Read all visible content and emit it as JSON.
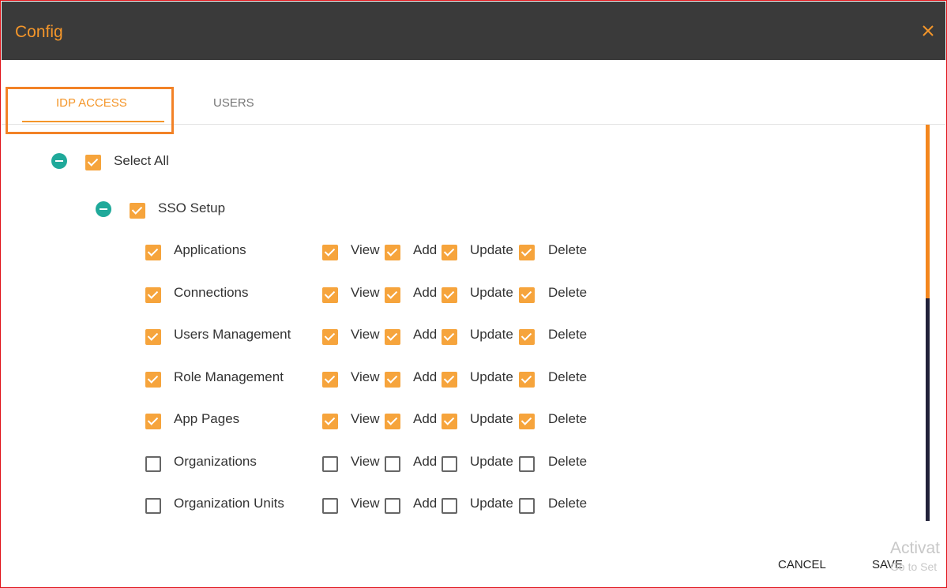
{
  "dialog": {
    "title": "Config"
  },
  "tabs": [
    {
      "label": "IDP ACCESS"
    },
    {
      "label": "USERS"
    }
  ],
  "tree": {
    "select_all": {
      "label": "Select All",
      "checked": true
    },
    "group": {
      "label": "SSO Setup",
      "checked": true
    },
    "permission_labels": [
      "View",
      "Add",
      "Update",
      "Delete"
    ],
    "rows": [
      {
        "label": "Applications",
        "checked": true,
        "perms": [
          true,
          true,
          true,
          true
        ]
      },
      {
        "label": "Connections",
        "checked": true,
        "perms": [
          true,
          true,
          true,
          true
        ]
      },
      {
        "label": "Users Management",
        "checked": true,
        "perms": [
          true,
          true,
          true,
          true
        ]
      },
      {
        "label": "Role Management",
        "checked": true,
        "perms": [
          true,
          true,
          true,
          true
        ]
      },
      {
        "label": "App Pages",
        "checked": true,
        "perms": [
          true,
          true,
          true,
          true
        ]
      },
      {
        "label": "Organizations",
        "checked": false,
        "perms": [
          false,
          false,
          false,
          false
        ]
      },
      {
        "label": "Organization Units",
        "checked": false,
        "perms": [
          false,
          false,
          false,
          false
        ]
      }
    ]
  },
  "footer": {
    "cancel_label": "CANCEL",
    "save_label": "SAVE"
  },
  "watermark": {
    "line1": "Activat",
    "line2": "Go to Set"
  },
  "colors": {
    "accent": "#f4962a",
    "header_bg": "#3a3a3a",
    "tree_toggle": "#1fa99a"
  }
}
